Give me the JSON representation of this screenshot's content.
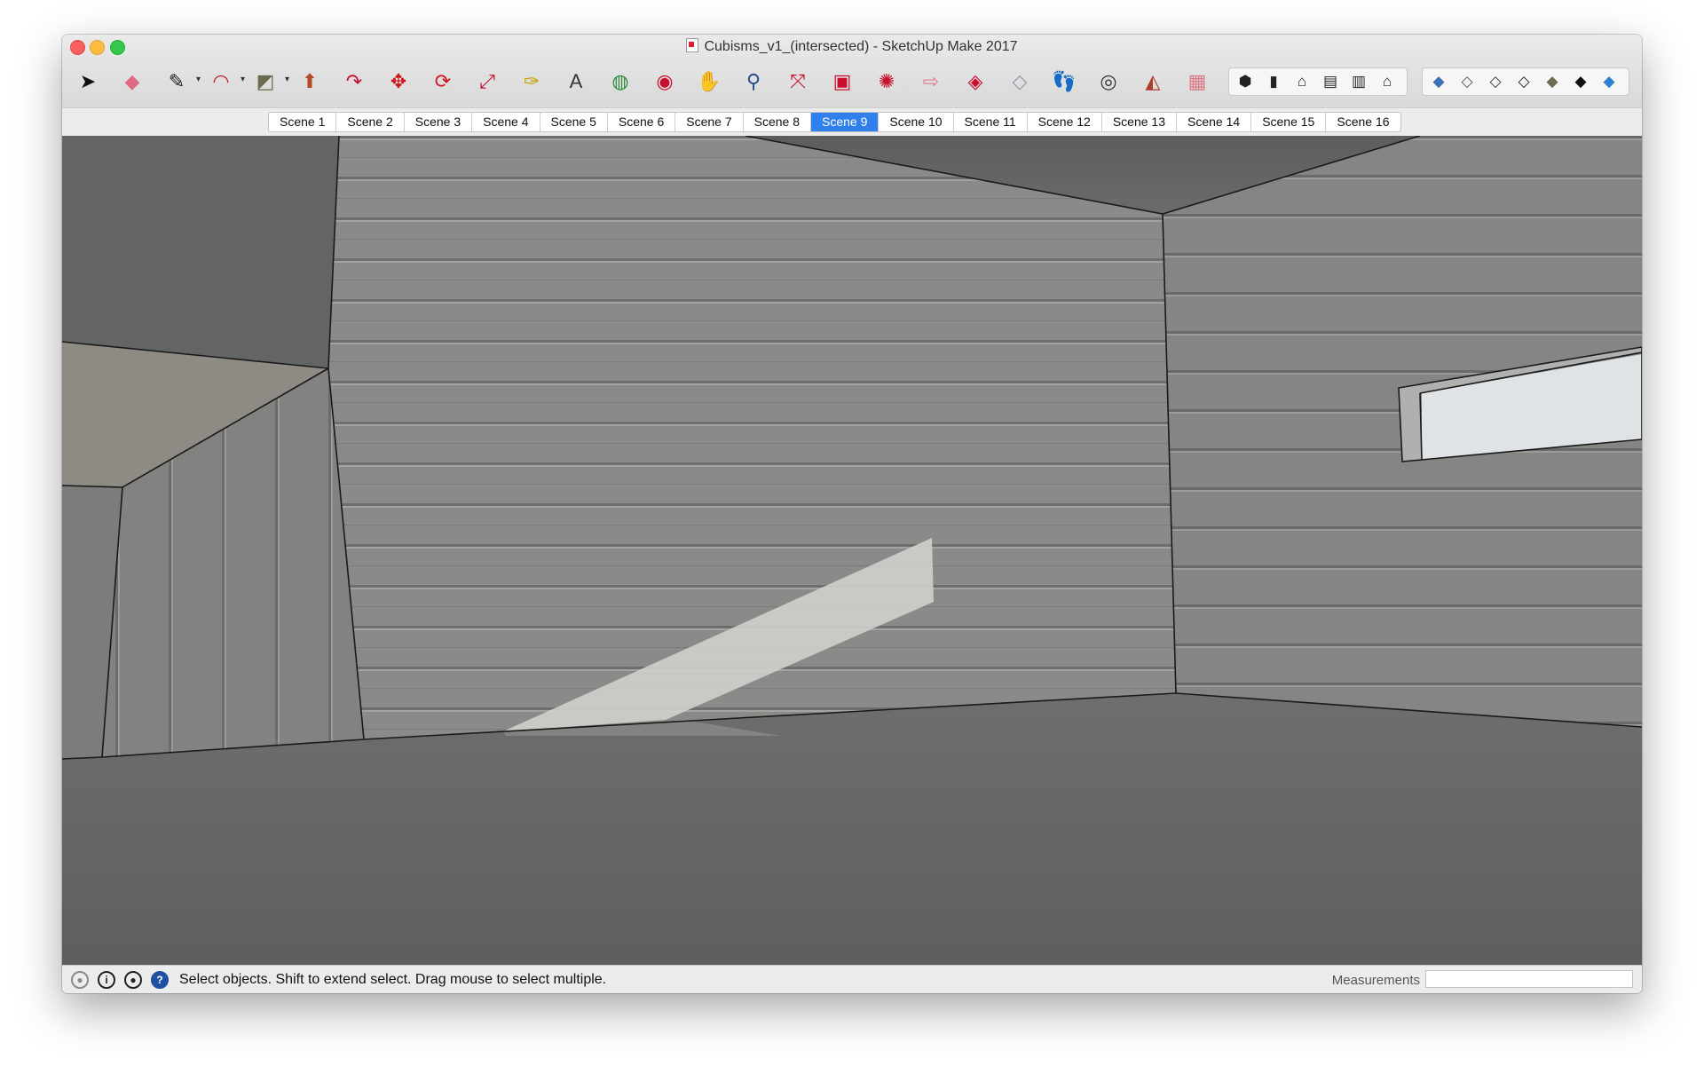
{
  "window": {
    "title": "Cubisms_v1_(intersected) - SketchUp Make 2017"
  },
  "toolbar": {
    "tools": [
      {
        "name": "select-tool-icon",
        "glyph": "➤",
        "color": "#111111",
        "dropdown": false
      },
      {
        "name": "eraser-tool-icon",
        "glyph": "◆",
        "color": "#e06a86",
        "dropdown": false
      },
      {
        "name": "pencil-tool-icon",
        "glyph": "✎",
        "color": "#222222",
        "dropdown": true
      },
      {
        "name": "arc-tool-icon",
        "glyph": "◠",
        "color": "#c02030",
        "dropdown": true
      },
      {
        "name": "rectangle-tool-icon",
        "glyph": "◩",
        "color": "#6b6b4f",
        "dropdown": true
      },
      {
        "name": "push-pull-tool-icon",
        "glyph": "⬆",
        "color": "#b44a2a",
        "dropdown": false
      },
      {
        "name": "follow-me-tool-icon",
        "glyph": "↷",
        "color": "#c8102e",
        "dropdown": false
      },
      {
        "name": "move-tool-icon",
        "glyph": "✥",
        "color": "#d0141f",
        "dropdown": false
      },
      {
        "name": "rotate-tool-icon",
        "glyph": "⟳",
        "color": "#d0141f",
        "dropdown": false
      },
      {
        "name": "scale-tool-icon",
        "glyph": "⤢",
        "color": "#c8102e",
        "dropdown": false
      },
      {
        "name": "tape-measure-tool-icon",
        "glyph": "✑",
        "color": "#c7a200",
        "dropdown": false
      },
      {
        "name": "text-tool-icon",
        "glyph": "A",
        "color": "#333333",
        "dropdown": false
      },
      {
        "name": "paint-bucket-tool-icon",
        "glyph": "◍",
        "color": "#2a8a3a",
        "dropdown": false
      },
      {
        "name": "orbit-tool-icon",
        "glyph": "◉",
        "color": "#c8102e",
        "dropdown": false
      },
      {
        "name": "pan-tool-icon",
        "glyph": "✋",
        "color": "#d9b36a",
        "dropdown": false
      },
      {
        "name": "zoom-tool-icon",
        "glyph": "⚲",
        "color": "#234b8f",
        "dropdown": false
      },
      {
        "name": "zoom-extents-tool-icon",
        "glyph": "⤧",
        "color": "#c8102e",
        "dropdown": false
      },
      {
        "name": "3d-warehouse-icon",
        "glyph": "▣",
        "color": "#c8102e",
        "dropdown": false
      },
      {
        "name": "extension-warehouse-icon",
        "glyph": "✺",
        "color": "#c8102e",
        "dropdown": false
      },
      {
        "name": "share-model-icon",
        "glyph": "⇨",
        "color": "#d97a86",
        "dropdown": false
      },
      {
        "name": "extension-manager-icon",
        "glyph": "◈",
        "color": "#c8102e",
        "dropdown": false
      },
      {
        "name": "section-plane-tool-icon",
        "glyph": "◇",
        "color": "#8a9aa8",
        "dropdown": false
      },
      {
        "name": "walk-tool-icon",
        "glyph": "👣",
        "color": "#111111",
        "dropdown": false
      },
      {
        "name": "look-around-tool-icon",
        "glyph": "◎",
        "color": "#333333",
        "dropdown": false
      },
      {
        "name": "position-camera-tool-icon",
        "glyph": "◭",
        "color": "#b03a2e",
        "dropdown": false
      },
      {
        "name": "sandbox-tool-icon",
        "glyph": "▦",
        "color": "#d97a86",
        "dropdown": false
      }
    ],
    "view_icons": [
      {
        "name": "iso-view-icon",
        "glyph": "⬢"
      },
      {
        "name": "top-view-icon",
        "glyph": "▮"
      },
      {
        "name": "front-view-icon",
        "glyph": "⌂"
      },
      {
        "name": "right-view-icon",
        "glyph": "▤"
      },
      {
        "name": "back-view-icon",
        "glyph": "▥"
      },
      {
        "name": "left-view-icon",
        "glyph": "⌂"
      }
    ],
    "style_icons": [
      {
        "name": "xray-style-icon",
        "glyph": "◆",
        "color": "#3b6fb6"
      },
      {
        "name": "wireframe-style-icon",
        "glyph": "◇",
        "color": "#555555"
      },
      {
        "name": "hidden-line-style-icon",
        "glyph": "◇",
        "color": "#333333"
      },
      {
        "name": "shaded-style-icon",
        "glyph": "◇",
        "color": "#222222"
      },
      {
        "name": "shaded-textures-style-icon",
        "glyph": "◆",
        "color": "#6b6b4f"
      },
      {
        "name": "monochrome-style-icon",
        "glyph": "◆",
        "color": "#111111"
      },
      {
        "name": "back-edges-style-icon",
        "glyph": "◆",
        "color": "#2f7fd0"
      }
    ]
  },
  "scenes": {
    "active_index": 8,
    "tabs": [
      "Scene 1",
      "Scene 2",
      "Scene 3",
      "Scene 4",
      "Scene 5",
      "Scene 6",
      "Scene 7",
      "Scene 8",
      "Scene 9",
      "Scene 10",
      "Scene 11",
      "Scene 12",
      "Scene 13",
      "Scene 14",
      "Scene 15",
      "Scene 16"
    ]
  },
  "status": {
    "text": "Select objects. Shift to extend select. Drag mouse to select multiple.",
    "measurements_label": "Measurements",
    "measurements_value": ""
  }
}
